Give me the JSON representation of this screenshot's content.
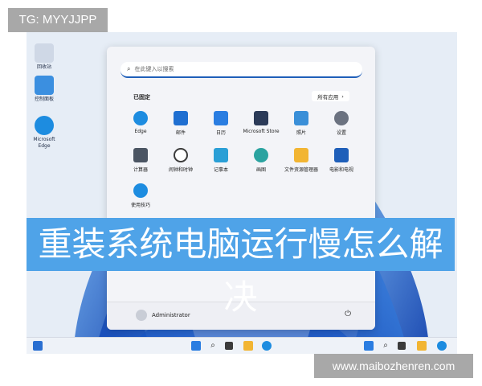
{
  "tg_label": "TG: MYYJJPP",
  "watermark": "www.maibozhenren.com",
  "desktop": {
    "icons": [
      {
        "label": "回收站"
      },
      {
        "label": "控制面板"
      },
      {
        "label": "Microsoft Edge"
      }
    ]
  },
  "start_menu": {
    "search_placeholder": "在此键入以搜索",
    "pinned_title": "已固定",
    "all_apps_label": "所有应用",
    "apps": [
      {
        "label": "Edge",
        "icon": "edge-icon",
        "color": "#1d8ce0"
      },
      {
        "label": "邮件",
        "icon": "mail-icon",
        "color": "#1f6fd1"
      },
      {
        "label": "日历",
        "icon": "calendar-icon",
        "color": "#2a7de1"
      },
      {
        "label": "Microsoft Store",
        "icon": "store-icon",
        "color": "#2b3a58"
      },
      {
        "label": "照片",
        "icon": "photos-icon",
        "color": "#3a8fd8"
      },
      {
        "label": "设置",
        "icon": "settings-icon",
        "color": "#6b7280"
      },
      {
        "label": "计算器",
        "icon": "calculator-icon",
        "color": "#4b5563"
      },
      {
        "label": "闹钟和时钟",
        "icon": "clock-icon",
        "color": "#3b3b3b"
      },
      {
        "label": "记事本",
        "icon": "notepad-icon",
        "color": "#2a9fd6"
      },
      {
        "label": "画图",
        "icon": "paint-icon",
        "color": "#2aa3a0"
      },
      {
        "label": "文件资源管理器",
        "icon": "folder-icon",
        "color": "#f2b533"
      },
      {
        "label": "电影和电视",
        "icon": "movies-icon",
        "color": "#1f5fb9"
      },
      {
        "label": "使用技巧",
        "icon": "tips-icon",
        "color": "#1d8ce0"
      }
    ],
    "user_name": "Administrator"
  },
  "banner_text": "重装系统电脑运行慢怎么解决",
  "colors": {
    "banner": "#4fa3e8",
    "accent": "#1f5fb9"
  }
}
